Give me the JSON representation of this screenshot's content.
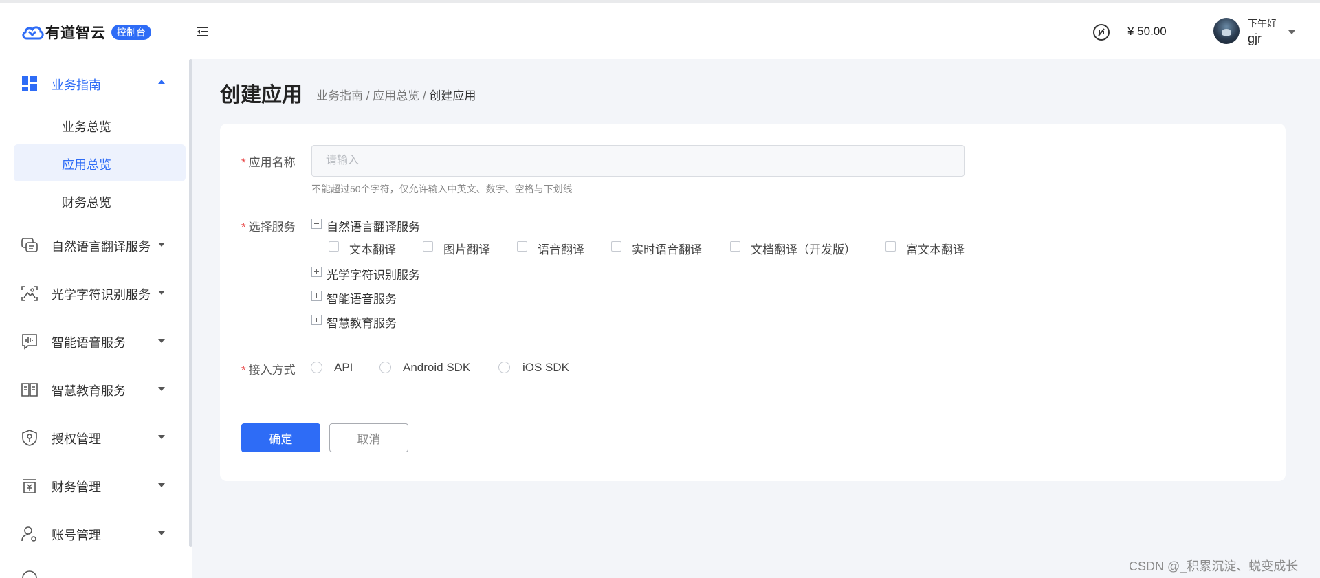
{
  "header": {
    "logo_text": "有道智云",
    "logo_badge": "控制台",
    "balance": "¥ 50.00",
    "greeting": "下午好",
    "username": "gjr",
    "icons": {
      "collapse": "menu-fold-icon",
      "coin": "coin-icon",
      "user_caret": "caret-down-icon"
    }
  },
  "sidebar": {
    "items": [
      {
        "label": "业务指南",
        "icon": "dashboard-icon",
        "open": true,
        "children": [
          {
            "label": "业务总览",
            "active": false
          },
          {
            "label": "应用总览",
            "active": true
          },
          {
            "label": "财务总览",
            "active": false
          }
        ]
      },
      {
        "label": "自然语言翻译服务",
        "icon": "translate-chat-icon"
      },
      {
        "label": "光学字符识别服务",
        "icon": "scan-image-icon"
      },
      {
        "label": "智能语音服务",
        "icon": "voice-wave-icon"
      },
      {
        "label": "智慧教育服务",
        "icon": "book-icon"
      },
      {
        "label": "授权管理",
        "icon": "shield-key-icon"
      },
      {
        "label": "财务管理",
        "icon": "finance-box-icon"
      },
      {
        "label": "账号管理",
        "icon": "user-gear-icon"
      }
    ]
  },
  "main": {
    "title": "创建应用",
    "breadcrumb": {
      "part1": "业务指南",
      "sep": " / ",
      "part2": "应用总览",
      "current": "创建应用"
    },
    "form": {
      "required_mark": "*",
      "app_name": {
        "label": "应用名称",
        "placeholder": "请输入",
        "value": "",
        "hint": "不能超过50个字符，仅允许输入中英文、数字、空格与下划线"
      },
      "services": {
        "label": "选择服务",
        "groups": [
          {
            "label": "自然语言翻译服务",
            "expanded": true,
            "options": [
              "文本翻译",
              "图片翻译",
              "语音翻译",
              "实时语音翻译",
              "文档翻译（开发版）",
              "富文本翻译"
            ]
          },
          {
            "label": "光学字符识别服务",
            "expanded": false
          },
          {
            "label": "智能语音服务",
            "expanded": false
          },
          {
            "label": "智慧教育服务",
            "expanded": false
          }
        ]
      },
      "access": {
        "label": "接入方式",
        "options": [
          "API",
          "Android SDK",
          "iOS SDK"
        ]
      },
      "confirm_label": "确定",
      "cancel_label": "取消"
    }
  },
  "watermark": "CSDN @_积累沉淀、蜕变成长",
  "colors": {
    "accent": "#2e6cf6",
    "background": "#f3f5f9",
    "required": "#e84545"
  }
}
